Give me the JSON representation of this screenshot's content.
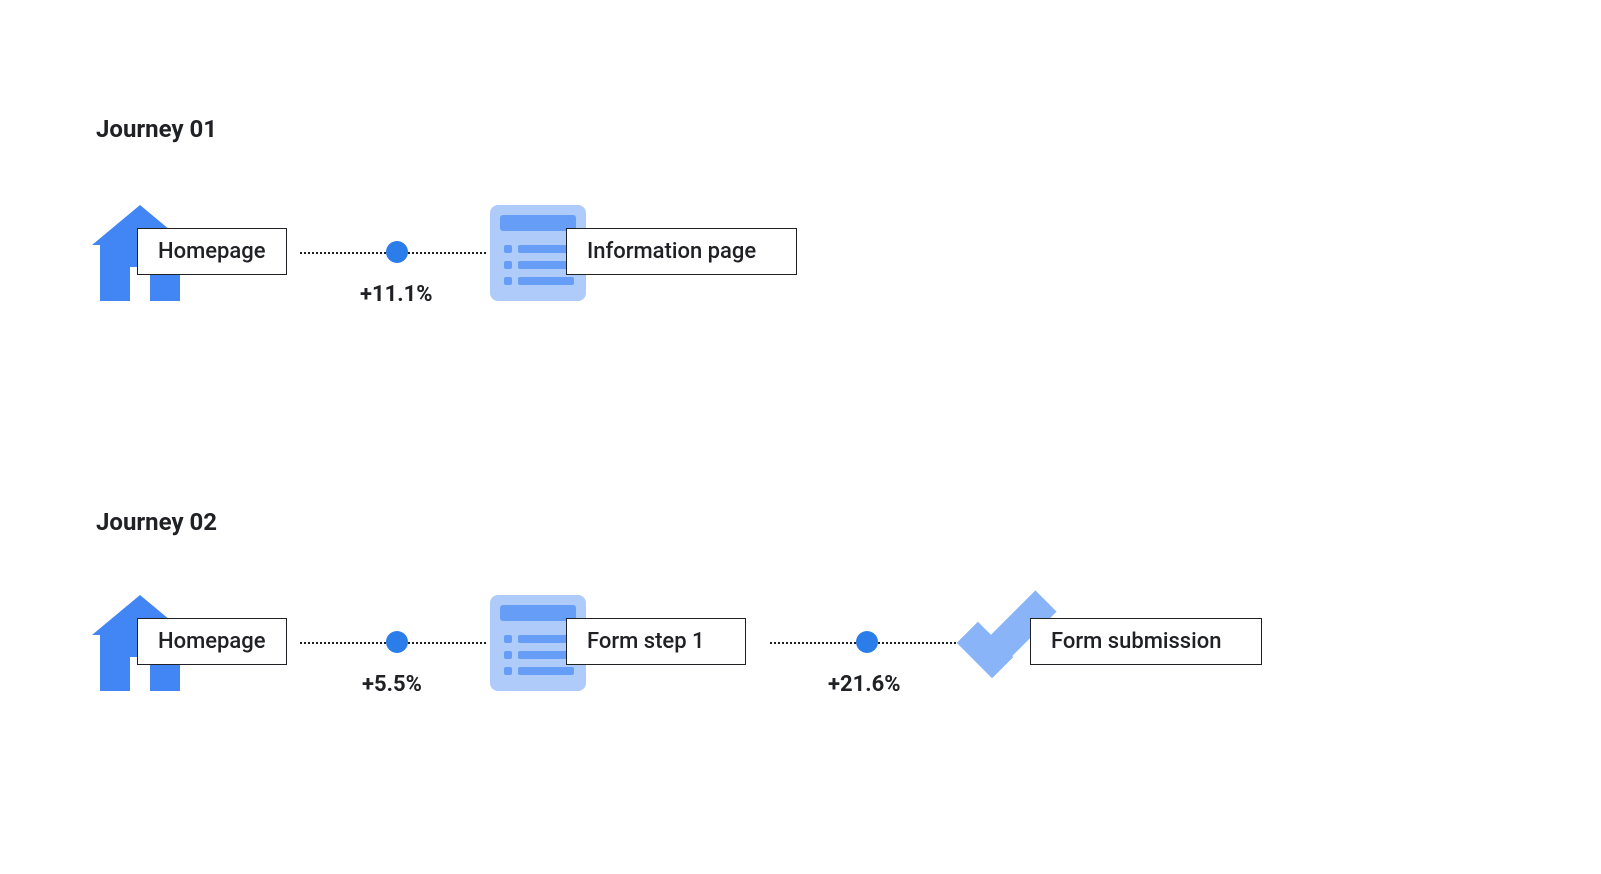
{
  "colors": {
    "icon_primary": "#4285f4",
    "icon_light": "#aecbfa",
    "icon_mid": "#669df6",
    "icon_check": "#8ab4f8",
    "connector_dot": "#2b7de9",
    "text": "#202124"
  },
  "journeys": [
    {
      "title": "Journey 01",
      "nodes": [
        {
          "icon": "house",
          "label": "Homepage"
        },
        {
          "icon": "list",
          "label": "Information page"
        }
      ],
      "connectors": [
        {
          "value": "+11.1%"
        }
      ]
    },
    {
      "title": "Journey 02",
      "nodes": [
        {
          "icon": "house",
          "label": "Homepage"
        },
        {
          "icon": "list",
          "label": "Form step 1"
        },
        {
          "icon": "check",
          "label": "Form submission"
        }
      ],
      "connectors": [
        {
          "value": "+5.5%"
        },
        {
          "value": "+21.6%"
        }
      ]
    }
  ]
}
